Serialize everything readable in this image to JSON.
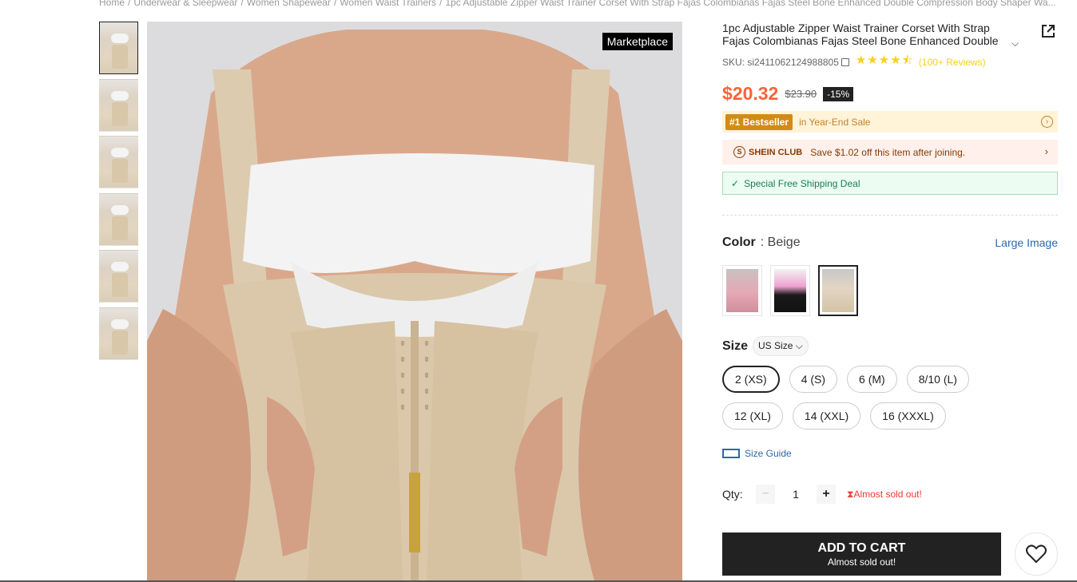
{
  "breadcrumb": [
    "Home",
    "Underwear & Sleepwear",
    "Women Shapewear",
    "Women Waist Trainers",
    "1pc Adjustable Zipper Waist Trainer Corset With Strap Fajas Colombianas Fajas Steel Bone Enhanced Double Compression Body Shaper Wa..."
  ],
  "gallery": {
    "badge": "Marketplace",
    "thumb_count": 6
  },
  "product": {
    "title": "1pc Adjustable Zipper Waist Trainer Corset With Strap Fajas Colombianas Fajas Steel Bone Enhanced Double",
    "sku": "SKU: si2411062124988805",
    "stars": "★★★★⯪",
    "rating": 4.5,
    "reviews": "(100+ Reviews)",
    "price": "$20.32",
    "old_price": "$23.90",
    "discount": "-15%"
  },
  "promos": {
    "bestseller_tag": "#1 Bestseller",
    "bestseller_text": "in Year-End Sale",
    "club_name": "SHEIN CLUB",
    "club_text": "Save $1.02 off this item after joining.",
    "shipping": "Special Free Shipping Deal"
  },
  "color": {
    "label": "Color",
    "value": ": Beige",
    "large_image": "Large Image",
    "options": [
      "pink",
      "black",
      "beige"
    ],
    "selected": "beige"
  },
  "size": {
    "label": "Size",
    "system": "US Size",
    "options": [
      "2 (XS)",
      "4 (S)",
      "6 (M)",
      "8/10 (L)",
      "12 (XL)",
      "14 (XXL)",
      "16 (XXXL)"
    ],
    "selected": "2 (XS)",
    "guide": "Size Guide"
  },
  "qty": {
    "label": "Qty:",
    "minus": "−",
    "value": "1",
    "plus": "+",
    "warning": "Almost sold out!"
  },
  "cart": {
    "label": "ADD TO CART",
    "sub": "Almost sold out!"
  },
  "colors": {
    "price": "#fa6338",
    "link": "#2d68a8",
    "cart": "#222222"
  }
}
